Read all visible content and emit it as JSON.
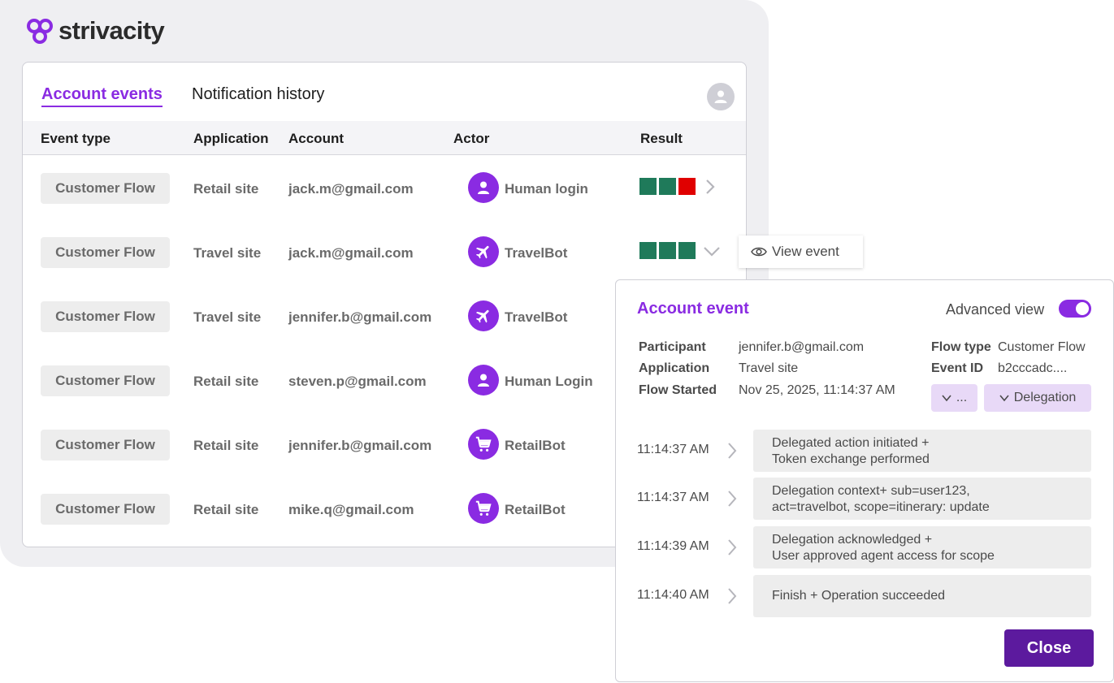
{
  "brand": {
    "name": "strivacity",
    "color": "#8a2be2"
  },
  "tabs": [
    {
      "label": "Account events",
      "active": true
    },
    {
      "label": "Notification history",
      "active": false
    }
  ],
  "columns": [
    "Event type",
    "Application",
    "Account",
    "Actor",
    "Result"
  ],
  "rows": [
    {
      "event_type": "Customer Flow",
      "application": "Retail site",
      "account": "jack.m@gmail.com",
      "actor": "Human login",
      "actor_icon": "person-icon",
      "results": [
        "success",
        "success",
        "fail"
      ],
      "caret": "chevron-right-icon"
    },
    {
      "event_type": "Customer Flow",
      "application": "Travel site",
      "account": "jack.m@gmail.com",
      "actor": "TravelBot",
      "actor_icon": "plane-icon",
      "results": [
        "success",
        "success",
        "success"
      ],
      "caret": "chevron-down-icon"
    },
    {
      "event_type": "Customer Flow",
      "application": "Travel site",
      "account": "jennifer.b@gmail.com",
      "actor": "TravelBot",
      "actor_icon": "plane-icon",
      "results": []
    },
    {
      "event_type": "Customer Flow",
      "application": "Retail site",
      "account": "steven.p@gmail.com",
      "actor": "Human Login",
      "actor_icon": "person-icon",
      "results": []
    },
    {
      "event_type": "Customer Flow",
      "application": "Retail site",
      "account": "jennifer.b@gmail.com",
      "actor": "RetailBot",
      "actor_icon": "cart-icon",
      "results": []
    },
    {
      "event_type": "Customer Flow",
      "application": "Retail site",
      "account": "mike.q@gmail.com",
      "actor": "RetailBot",
      "actor_icon": "cart-icon",
      "results": []
    }
  ],
  "status_colors": {
    "success": "#1f7a5a",
    "fail": "#e00000"
  },
  "view_event": {
    "label": "View event",
    "icon": "eye-icon"
  },
  "detail": {
    "title": "Account event",
    "advanced_view_label": "Advanced view",
    "advanced_view_on": true,
    "participant_label": "Participant",
    "participant": "jennifer.b@gmail.com",
    "application_label": "Application",
    "application": "Travel site",
    "flow_started_label": "Flow Started",
    "flow_started": "Nov 25, 2025, 11:14:37 AM",
    "flow_type_label": "Flow type",
    "flow_type": "Customer Flow",
    "event_id_label": "Event ID",
    "event_id": "b2cccadc....",
    "pill_more": "...",
    "pill_delegation": "Delegation",
    "timeline": [
      {
        "time": "11:14:37 AM",
        "line1": "Delegated action initiated +",
        "line2": "Token exchange performed"
      },
      {
        "time": "11:14:37 AM",
        "line1": "Delegation context+ sub=user123,",
        "line2": "act=travelbot, scope=itinerary: update"
      },
      {
        "time": "11:14:39 AM",
        "line1": "Delegation acknowledged +",
        "line2": "User approved agent access for scope"
      },
      {
        "time": "11:14:40 AM",
        "line1": "Finish + Operation succeeded",
        "line2": ""
      }
    ],
    "close_label": "Close"
  }
}
